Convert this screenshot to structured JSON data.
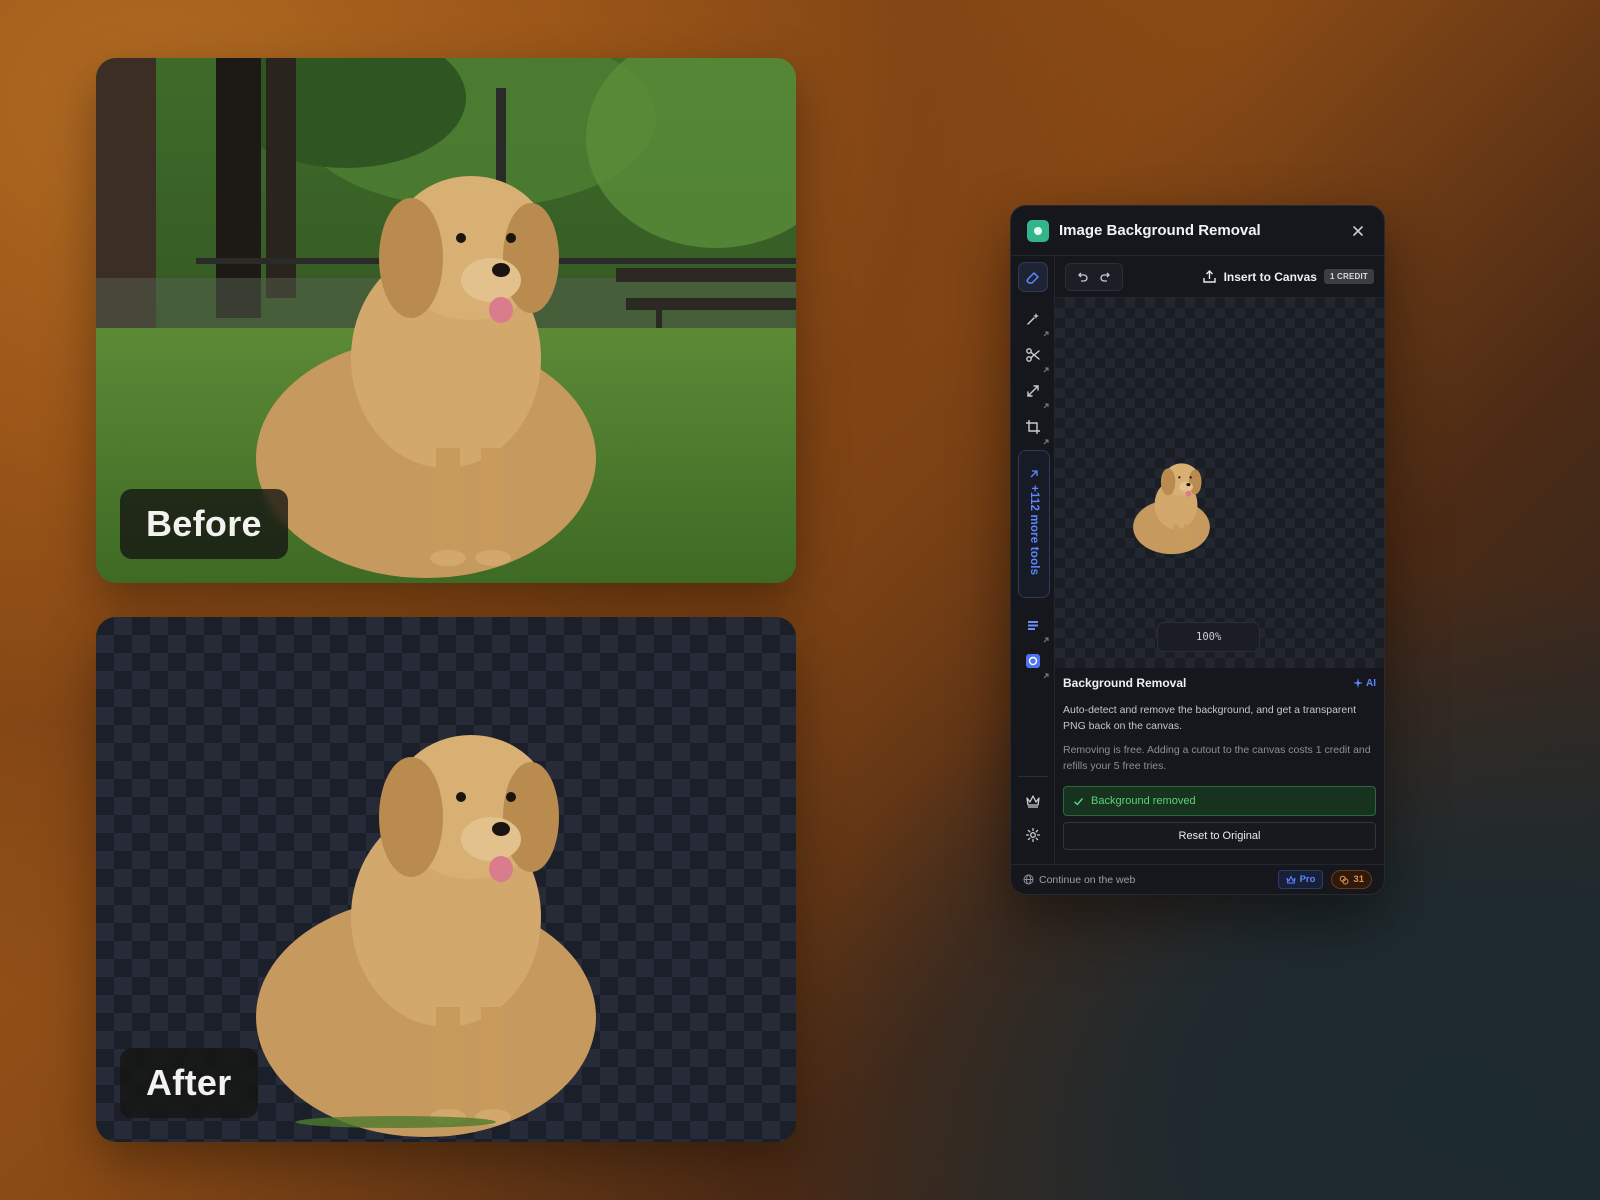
{
  "before_card": {
    "label": "Before"
  },
  "after_card": {
    "label": "After"
  },
  "panel": {
    "title": "Image Background Removal",
    "toolbar": {
      "insert_label": "Insert to Canvas",
      "credit_badge": "1 CREDIT"
    },
    "sidebar": {
      "more_tools": "+112 more tools"
    },
    "zoom": {
      "value": "100%"
    },
    "info": {
      "title": "Background Removal",
      "ai_tag": "AI",
      "description": "Auto-detect and remove the background, and get a transparent PNG back on the canvas.",
      "note": "Removing is free. Adding a cutout to the canvas costs 1 credit and refills your 5 free tries.",
      "status": "Background removed",
      "reset_label": "Reset to Original"
    },
    "footer": {
      "web_link": "Continue on the web",
      "pro_label": "Pro",
      "credits": "31"
    }
  },
  "colors": {
    "accent": "#5d86ff",
    "success": "#5fd07d",
    "logo": "#34b48a",
    "credits": "#e3904a"
  }
}
